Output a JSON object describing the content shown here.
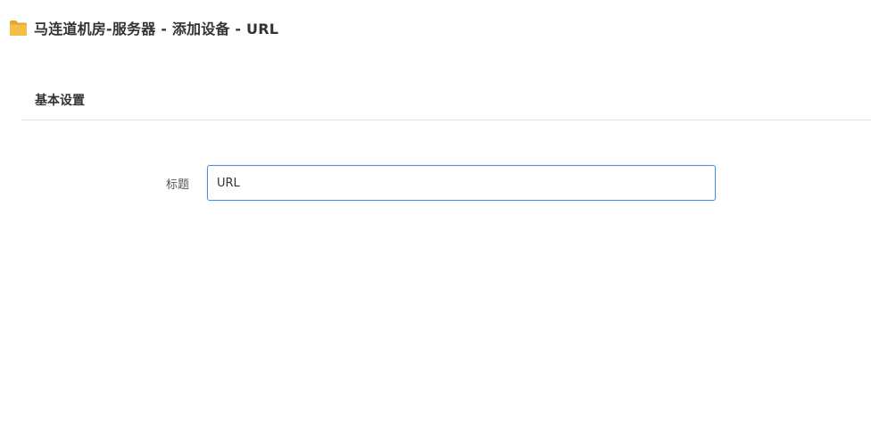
{
  "header": {
    "title": "马连道机房-服务器 - 添加设备 - URL",
    "icon": "folder-icon",
    "icon_color": "#f0b93a"
  },
  "section": {
    "title": "基本设置"
  },
  "form": {
    "title_label": "标题",
    "title_value": "URL",
    "focus_color": "#4a90d9"
  }
}
